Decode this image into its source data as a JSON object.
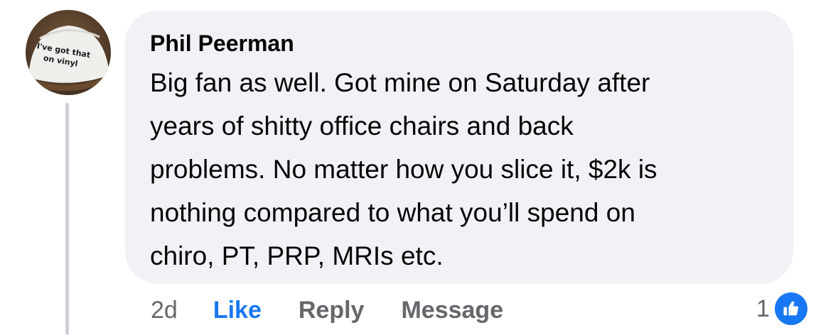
{
  "comment": {
    "author": "Phil Peerman",
    "text": "Big fan as well.  Got mine on Saturday after\nyears of shitty office chairs and back\nproblems.   No matter how you slice it, $2k is\nnothing compared to what you’ll spend on\nchiro, PT, PRP, MRIs etc.",
    "avatar_caption_line1": "I've got that",
    "avatar_caption_line2": "on vinyl"
  },
  "actions": {
    "time": "2d",
    "like_label": "Like",
    "reply_label": "Reply",
    "message_label": "Message"
  },
  "reactions": {
    "count": "1",
    "icon": "thumbs-up-icon"
  },
  "colors": {
    "bubble_bg": "#f0f2f5",
    "link_blue": "#1877f2",
    "secondary_text": "#65676b",
    "primary_text": "#050505",
    "thread_line": "#ccd0d5"
  }
}
